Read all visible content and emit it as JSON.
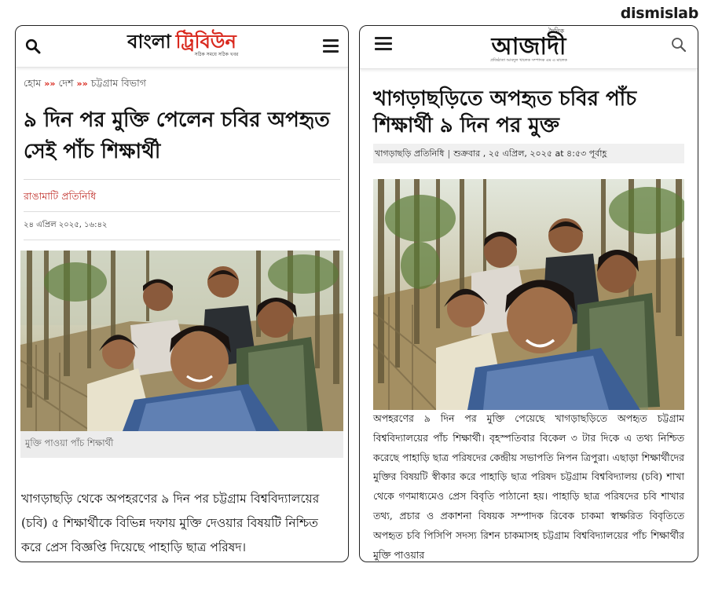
{
  "brand": "dismislab",
  "left": {
    "logo": {
      "part1": "বাংলা",
      "part2": "ট্রিবিউন",
      "tagline": "সঠিক সময়ে সঠিক খবর"
    },
    "breadcrumb": [
      "হোম",
      "দেশ",
      "চট্টগ্রাম বিভাগ"
    ],
    "breadcrumb_sep": "»",
    "title": "৯ দিন পর মুক্তি পেলেন চবির অপহৃত সেই পাঁচ শিক্ষার্থী",
    "author": "রাঙামাটি প্রতিনিধি",
    "date": "২৪ এপ্রিল ২০২৫, ১৬:৪২",
    "photo_caption": "মুক্তি পাওয়া পাঁচ শিক্ষার্থী",
    "body": "খাগড়াছড়ি থেকে অপহরণের ৯ দিন পর চট্টগ্রাম বিশ্ববিদ্যালয়ের (চবি) ৫ শিক্ষার্থীকে বিভিন্ন দফায় মুক্তি দেওয়ার বিষয়টি নিশ্চিত করে প্রেস বিজ্ঞপ্তি দিয়েছে পাহাড়ি ছাত্র পরিষদ।"
  },
  "right": {
    "logo": {
      "pre": "দৈনিক",
      "main": "আজাদী",
      "tagline": "প্রতিষ্ঠাতা আবদুল খালেক সম্পাদক এম এ মালেক"
    },
    "title": "খাগড়াছড়িতে অপহৃত চবির পাঁচ শিক্ষার্থী ৯ দিন পর মুক্ত",
    "meta": {
      "author": "খাগড়াছড়ি প্রতিনিধি",
      "sep": "|",
      "date": "শুক্রবার , ২৫ এপ্রিল, ২০২৫ at ৪:৫৩ পূর্বাহ্ণ"
    },
    "body": "অপহরণের ৯ দিন পর মুক্তি পেয়েছে খাগড়াছড়িতে অপহৃত চট্টগ্রাম বিশ্ববিদ্যালয়ের পাঁচ শিক্ষার্থী। বৃহস্পতিবার বিকেল ৩ টার দিকে এ তথ্য নিশ্চিত করেছে পাহাড়ি ছাত্র পরিষদের কেন্দ্রীয় সভাপতি নিপন ত্রিপুরা। এছাড়া শিক্ষার্থীদের মুক্তির বিষয়টি স্বীকার করে পাহাড়ি ছাত্র পরিষদ চট্টগ্রাম বিশ্ববিদ্যালয় (চবি) শাখা থেকে গণমাধ্যমেও প্রেস বিবৃতি পাঠানো হয়। পাহাড়ি ছাত্র পরিষদের চবি শাখার তথ্য, প্রচার ও প্রকাশনা বিষয়ক সম্পাদক রিবেক চাকমা স্বাক্ষরিত বিবৃতিতে অপহৃত চবি পিসিপি সদস্য রিশন চাকমাসহ চট্টগ্রাম বিশ্ববিদ্যালয়ের পাঁচ শিক্ষার্থীর মুক্তি পাওয়ার"
  },
  "icons": [
    "search-icon",
    "hamburger-menu-icon"
  ],
  "colors": {
    "tribune_red": "#d9281d",
    "author_red": "#c0302a",
    "caption_bg": "#ececec",
    "meta_bg": "#f0f0f0"
  }
}
